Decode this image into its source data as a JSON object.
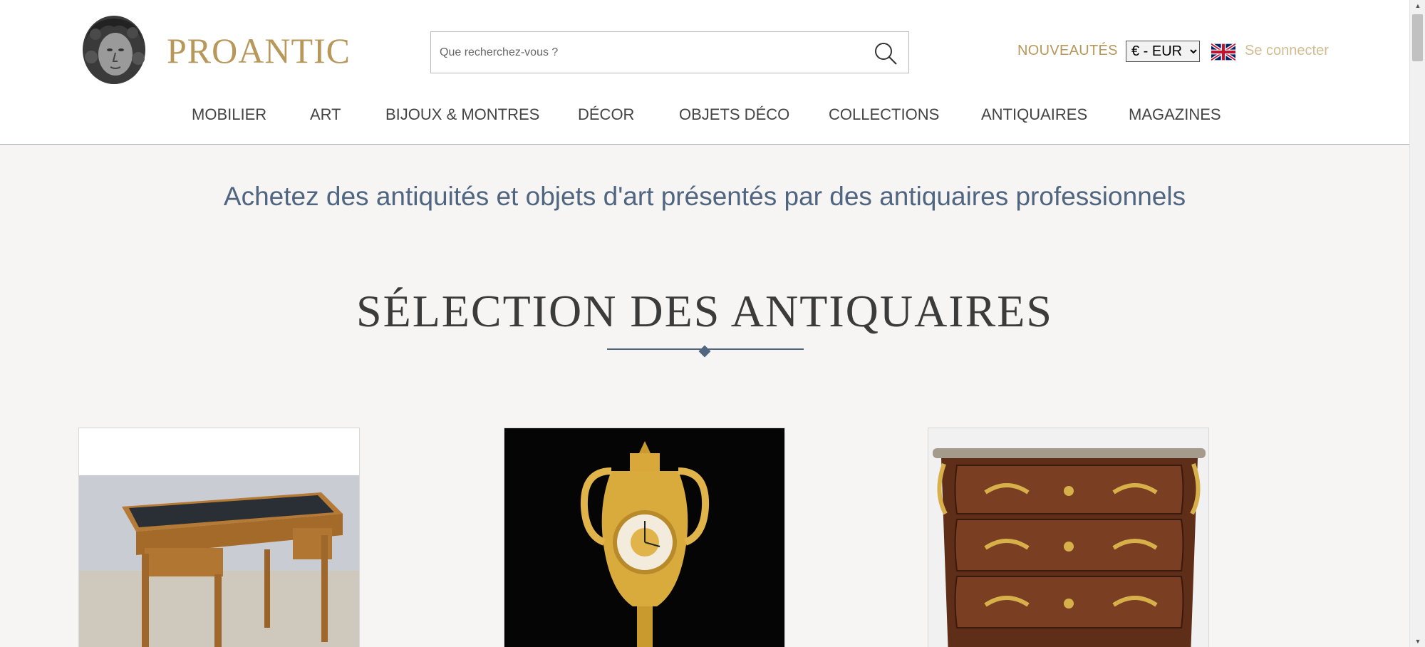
{
  "header": {
    "logo_text": "PROANTIC",
    "search_placeholder": "Que recherchez-vous ?",
    "nouveautes": "NOUVEAUTÉS",
    "currency_selected": "€ - EUR",
    "login": "Se connecter",
    "brand_color": "#b8975a"
  },
  "nav": {
    "items": [
      {
        "label": "MOBILIER"
      },
      {
        "label": "ART"
      },
      {
        "label": "BIJOUX & MONTRES"
      },
      {
        "label": "DÉCOR"
      },
      {
        "label": "OBJETS DÉCO"
      },
      {
        "label": "COLLECTIONS"
      },
      {
        "label": "ANTIQUAIRES"
      },
      {
        "label": "MAGAZINES"
      }
    ]
  },
  "main": {
    "tagline": "Achetez des antiquités et objets d'art présentés par des antiquaires professionnels",
    "section_title": "SÉLECTION DES ANTIQUAIRES",
    "accent_color": "#4f6580"
  },
  "icons": {
    "search": "search-icon",
    "flag": "uk-flag-icon",
    "logo": "bust-logo-icon"
  }
}
